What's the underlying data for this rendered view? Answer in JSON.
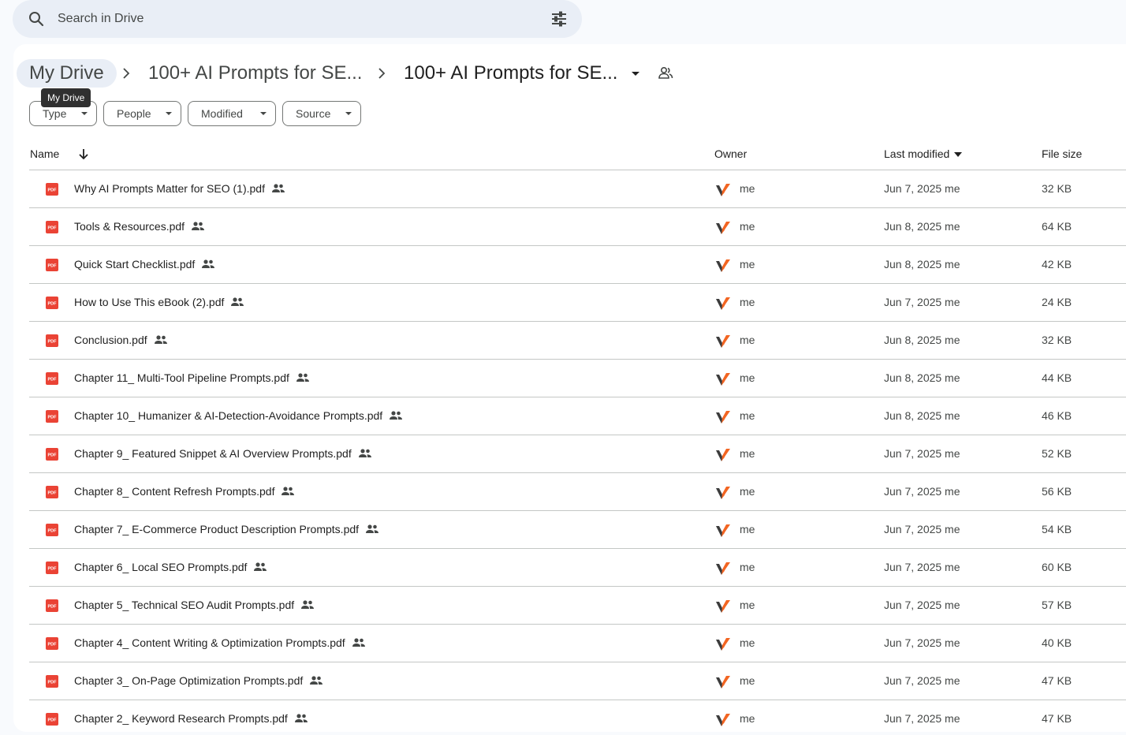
{
  "search": {
    "placeholder": "Search in Drive"
  },
  "breadcrumb": {
    "root": "My Drive",
    "middle": "100+ AI Prompts for SE...",
    "current": "100+ AI Prompts for SE..."
  },
  "tooltip": "My Drive",
  "filters": {
    "type": "Type",
    "people": "People",
    "modified": "Modified",
    "source": "Source"
  },
  "columns": {
    "name": "Name",
    "owner": "Owner",
    "modified": "Last modified",
    "size": "File size"
  },
  "colors": {
    "pdf_red": "#ea4335",
    "avatar_orange": "#f26522",
    "avatar_dark": "#3c3c3c"
  },
  "files": [
    {
      "name": "Why AI Prompts Matter for SEO (1).pdf",
      "owner": "me",
      "modified": "Jun 7, 2025 me",
      "size": "32 KB"
    },
    {
      "name": "Tools & Resources.pdf",
      "owner": "me",
      "modified": "Jun 8, 2025 me",
      "size": "64 KB"
    },
    {
      "name": "Quick Start Checklist.pdf",
      "owner": "me",
      "modified": "Jun 8, 2025 me",
      "size": "42 KB"
    },
    {
      "name": "How to Use This eBook (2).pdf",
      "owner": "me",
      "modified": "Jun 7, 2025 me",
      "size": "24 KB"
    },
    {
      "name": "Conclusion.pdf",
      "owner": "me",
      "modified": "Jun 8, 2025 me",
      "size": "32 KB"
    },
    {
      "name": "Chapter 11_ Multi-Tool Pipeline Prompts.pdf",
      "owner": "me",
      "modified": "Jun 8, 2025 me",
      "size": "44 KB"
    },
    {
      "name": "Chapter 10_ Humanizer & AI-Detection-Avoidance Prompts.pdf",
      "owner": "me",
      "modified": "Jun 8, 2025 me",
      "size": "46 KB"
    },
    {
      "name": "Chapter 9_ Featured Snippet & AI Overview Prompts.pdf",
      "owner": "me",
      "modified": "Jun 7, 2025 me",
      "size": "52 KB"
    },
    {
      "name": "Chapter 8_ Content Refresh Prompts.pdf",
      "owner": "me",
      "modified": "Jun 7, 2025 me",
      "size": "56 KB"
    },
    {
      "name": "Chapter 7_ E-Commerce Product Description Prompts.pdf",
      "owner": "me",
      "modified": "Jun 7, 2025 me",
      "size": "54 KB"
    },
    {
      "name": "Chapter 6_ Local SEO Prompts.pdf",
      "owner": "me",
      "modified": "Jun 7, 2025 me",
      "size": "60 KB"
    },
    {
      "name": "Chapter 5_ Technical SEO Audit Prompts.pdf",
      "owner": "me",
      "modified": "Jun 7, 2025 me",
      "size": "57 KB"
    },
    {
      "name": "Chapter 4_ Content Writing & Optimization Prompts.pdf",
      "owner": "me",
      "modified": "Jun 7, 2025 me",
      "size": "40 KB"
    },
    {
      "name": "Chapter 3_ On-Page Optimization Prompts.pdf",
      "owner": "me",
      "modified": "Jun 7, 2025 me",
      "size": "47 KB"
    },
    {
      "name": "Chapter 2_ Keyword Research Prompts.pdf",
      "owner": "me",
      "modified": "Jun 7, 2025 me",
      "size": "47 KB"
    }
  ]
}
